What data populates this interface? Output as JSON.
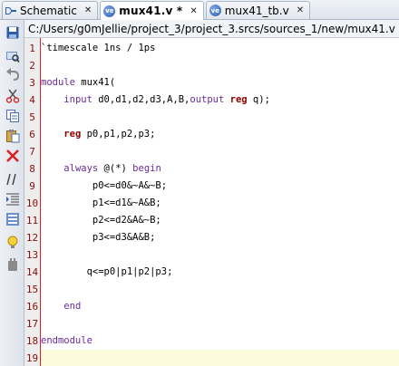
{
  "tabs": [
    {
      "label": "Schematic",
      "icon": "schematic-icon",
      "active": false
    },
    {
      "label": "mux41.v *",
      "icon": "verilog-file-icon",
      "active": true
    },
    {
      "label": "mux41_tb.v",
      "icon": "verilog-file-icon",
      "active": false
    }
  ],
  "file_path": "C:/Users/g0mJellie/project_3/project_3.srcs/sources_1/new/mux41.v",
  "toolbar": [
    "save-icon",
    "find-icon",
    "undo-icon",
    "cut-icon",
    "copy-icon",
    "paste-icon",
    "delete-icon",
    "comment-icon",
    "indent-icon",
    "block-icon",
    "hint-icon",
    "plugin-icon"
  ],
  "colors": {
    "keyword": "#6a2b9a",
    "reg_keyword": "#8b0000",
    "line_number": "#8a0d0d",
    "current_line": "#fcfcdc",
    "margin": "#e02020"
  },
  "current_line": 19,
  "code": [
    [
      {
        "t": "`timescale 1ns / 1ps",
        "c": "tk"
      }
    ],
    [],
    [
      {
        "t": "module",
        "c": "kw"
      },
      {
        "t": " mux41(",
        "c": "tk"
      }
    ],
    [
      {
        "t": "    ",
        "c": "tk"
      },
      {
        "t": "input",
        "c": "kw"
      },
      {
        "t": " d0,d1,d2,d3,A,B,",
        "c": "tk"
      },
      {
        "t": "output",
        "c": "kw"
      },
      {
        "t": " ",
        "c": "tk"
      },
      {
        "t": "reg",
        "c": "rg"
      },
      {
        "t": " q);",
        "c": "tk"
      }
    ],
    [],
    [
      {
        "t": "    ",
        "c": "tk"
      },
      {
        "t": "reg",
        "c": "rg"
      },
      {
        "t": " p0,p1,p2,p3;",
        "c": "tk"
      }
    ],
    [],
    [
      {
        "t": "    ",
        "c": "tk"
      },
      {
        "t": "always",
        "c": "kw"
      },
      {
        "t": " @(*) ",
        "c": "tk"
      },
      {
        "t": "begin",
        "c": "kw"
      }
    ],
    [
      {
        "t": "         p0<=d0&~A&~B;",
        "c": "tk"
      }
    ],
    [
      {
        "t": "         p1<=d1&~A&B;",
        "c": "tk"
      }
    ],
    [
      {
        "t": "         p2<=d2&A&~B;",
        "c": "tk"
      }
    ],
    [
      {
        "t": "         p3<=d3&A&B;",
        "c": "tk"
      }
    ],
    [],
    [
      {
        "t": "        q<=p0|p1|p2|p3;",
        "c": "tk"
      }
    ],
    [],
    [
      {
        "t": "    ",
        "c": "tk"
      },
      {
        "t": "end",
        "c": "kw"
      }
    ],
    [],
    [
      {
        "t": "endmodule",
        "c": "kw"
      }
    ],
    []
  ]
}
